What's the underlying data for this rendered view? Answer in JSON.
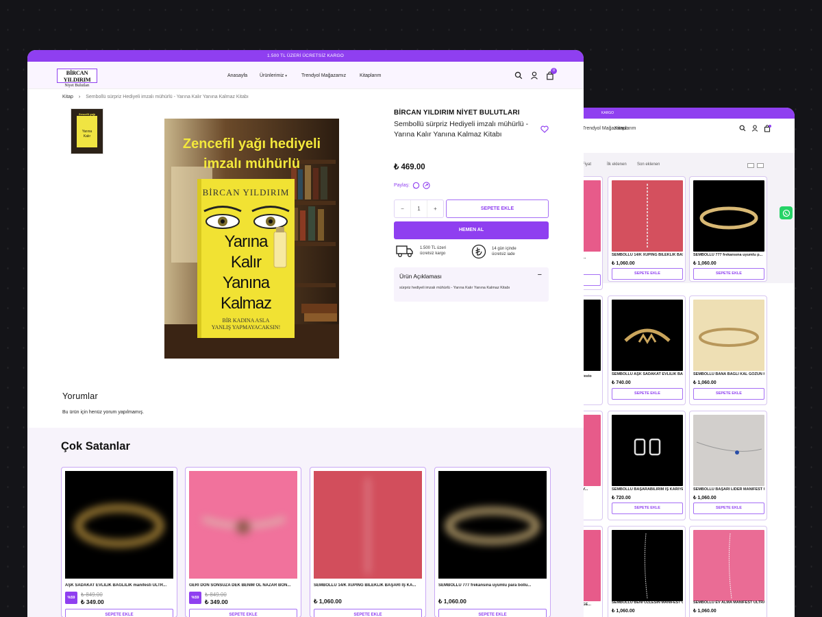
{
  "colors": {
    "accent": "#8f3ff0",
    "whatsapp": "#25d366",
    "dark_bg": "#141418"
  },
  "main": {
    "topbar": "1.500 TL ÜZERİ ÜCRETSİZ KARGO",
    "logo": {
      "line1": "BİRCAN YILDIRIM",
      "line2": "Niyet Bulutları"
    },
    "menu": [
      "Anasayfa",
      "Ürünlerimiz",
      "Trendyol Mağazamız",
      "Kitaplarım"
    ],
    "cart_count": "0",
    "breadcrumb": {
      "root": "Kitap",
      "current": "Sembollü sürpriz Hediyeli imzalı mühürlü - Yarına Kalır Yanına Kalmaz Kitabı"
    },
    "cover": {
      "top_text_1": "Zencefil yağı hediyeli",
      "top_text_2": "imzalı mühürlü",
      "author": "BİRCAN YILDIRIM",
      "title_1": "Yarına",
      "title_2": "Kalır",
      "title_3": "Yanına",
      "title_4": "Kalmaz",
      "tagline_1": "BİR KADINA ASLA",
      "tagline_2": "YANLIŞ YAPMAYACAKSIN!"
    },
    "product": {
      "brand": "BİRCAN YILDIRIM NİYET BULUTLARI",
      "title": "Sembollü sürpriz Hediyeli imzalı mühürlü - Yarına Kalır Yanına Kalmaz Kitabı",
      "price": "₺ 469.00",
      "share_label": "Paylaş:",
      "qty_minus": "−",
      "qty_value": "1",
      "qty_plus": "+",
      "add_to_cart": "SEPETE EKLE",
      "buy_now": "HEMEN AL",
      "feature1_l1": "1.500 TL üzeri",
      "feature1_l2": "ücretsiz kargo",
      "feature2_l1": "14 gün içinde",
      "feature2_l2": "ücretsiz iade",
      "desc_title": "Ürün Açıklaması",
      "desc_toggle": "−",
      "desc_text": "sürpriz  hediyeli imzalı mühürlü  - Yarına Kalır Yanına Kalmaz Kitabı"
    },
    "reviews": {
      "title": "Yorumlar",
      "empty": "Bu ürün için henüz yorum yapılmamış."
    },
    "bestsellers": {
      "title": "Çok Satanlar",
      "items": [
        {
          "name": "AŞK SADAKAT EVLİLİK BAĞLILIK manifesti ULTR...",
          "badge": "%59",
          "old_price": "₺ 849.00",
          "price": "₺ 349.00",
          "button": "SEPETE EKLE"
        },
        {
          "name": "GERİ DÖN SONSUZA DEK BENİM OL NAZAR BON...",
          "badge": "%59",
          "old_price": "₺ 849.00",
          "price": "₺ 349.00",
          "button": "SEPETE EKLE"
        },
        {
          "name": "SEMBOLLÜ 14/K XUPING BİLEKLİK BAŞARI İŞ KA...",
          "price": "₺ 1,060.00",
          "button": "SEPETE EKLE"
        },
        {
          "name": "SEMBOLLÜ 777 frekansına uyumlu para bollu...",
          "price": "₺ 1,060.00",
          "button": "SEPETE EKLE"
        }
      ]
    }
  },
  "back": {
    "topbar": "KARGO",
    "menu": [
      "Trendyol Mağazamız",
      "Kitaplarım"
    ],
    "cart_count": "0",
    "filters": [
      "Fiyat",
      "İlk eklenen",
      "Son eklenen"
    ],
    "products": [
      {
        "name": "SEMBOLLÜ 14/K XUPING BİLEKLİK BAŞ...",
        "price": "₺ 1,060.00",
        "button": "SEPETE EKLE"
      },
      {
        "name": "SEMBOLLÜ 777 frekansına uyumlu p...",
        "price": "₺ 1,060.00",
        "button": "SEPETE EKLE"
      },
      {
        "name": "SEMBOLLÜ AŞK SADAKAT EVLİLİK BA...",
        "price": "₺ 740.00",
        "button": "SEPETE EKLE"
      },
      {
        "name": "SEMBOLLÜ BANA BAĞLI KAL GÖZÜN H...",
        "price": "₺ 1,060.00",
        "button": "SEPETE EKLE"
      },
      {
        "name": "SEMBOLLÜ BAŞARABİLİRİM İŞ KARİYE...",
        "price": "₺ 720.00",
        "button": "SEPETE EKLE"
      },
      {
        "name": "SEMBOLLÜ BAŞARI LİDER MANİFEST U...",
        "price": "₺ 1,060.00",
        "button": "SEPETE EKLE"
      },
      {
        "name": "SEMBOLLÜ BENİ ÖZLESİN MANİFEST U...",
        "price": "₺ 1,060.00",
        "button": "SEPETE EKLE"
      },
      {
        "name": "SEMBOLLÜ EV ALMA MANİFEST ULTRA...",
        "price": "₺ 1,060.00",
        "button": "SEPETE EKLE"
      }
    ],
    "partial": [
      {
        "name": "...NL Ö...",
        "price": "₺",
        "button": ""
      },
      {
        "name": "...manifesto",
        "price": "₺",
        "button": ""
      },
      {
        "name": "...HEDİY...",
        "price": "₺",
        "button": ""
      },
      {
        "name": "...ÜTR GE...",
        "price": "₺",
        "button": ""
      }
    ]
  }
}
